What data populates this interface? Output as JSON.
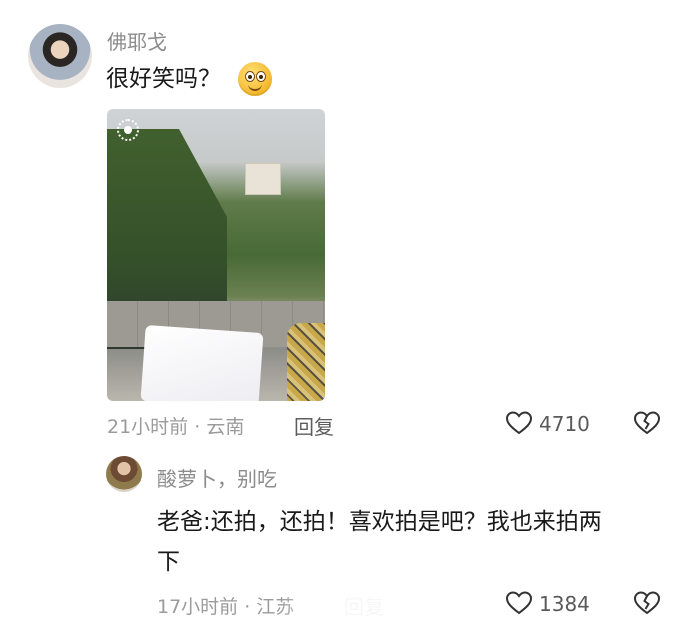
{
  "comments": [
    {
      "username": "佛耶戈",
      "text": "很好笑吗？",
      "emoji_icon": "grinning-face-emoji",
      "time": "21小时前",
      "location": "云南",
      "reply_label": "回复",
      "likes": "4710"
    },
    {
      "username": "酸萝卜，别吃",
      "text_line1": "老爸:还拍，还拍！喜欢拍是吧？我也来拍两",
      "text_line2": "下",
      "time": "17小时前",
      "location": "江苏",
      "reply_label": "回复",
      "likes": "1384"
    }
  ],
  "separator": " · "
}
